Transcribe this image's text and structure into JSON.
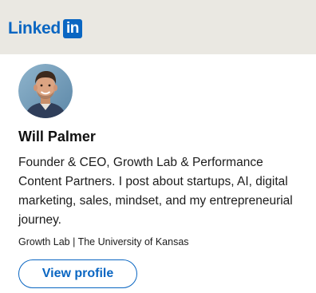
{
  "header": {
    "logo_word": "Linked",
    "logo_box": "in"
  },
  "profile": {
    "name": "Will Palmer",
    "headline": "Founder & CEO, Growth Lab & Performance Content Partners. I post about startups, AI, digital marketing, sales, mindset, and my entrepreneurial journey.",
    "company": "Growth Lab | The University of Kansas",
    "view_profile_label": "View profile"
  },
  "colors": {
    "brand_blue": "#0a66c2",
    "header_bg": "#eae8e2",
    "card_bg": "#ffffff",
    "frame_bg": "#000000"
  },
  "icons": {
    "logo": "linkedin-logo-icon",
    "avatar": "profile-photo"
  }
}
